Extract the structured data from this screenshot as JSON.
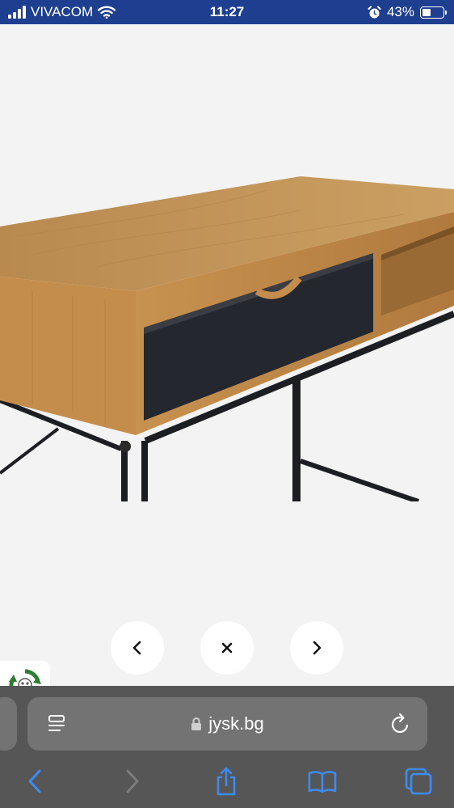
{
  "status_bar": {
    "carrier": "VIVACOM",
    "time": "11:27",
    "battery": "43%",
    "battery_level": 0.43,
    "icons": [
      "signal-icon",
      "wifi-icon",
      "alarm-icon",
      "battery-icon"
    ]
  },
  "viewer": {
    "image": "product-photo-desk-oak-black-drawer",
    "buttons": {
      "prev": "chevron-left-icon",
      "close": "close-icon",
      "next": "chevron-right-icon"
    },
    "badge_icon": "recycle-icon"
  },
  "browser": {
    "domain": "jysk.bg",
    "icons": [
      "reader-icon",
      "lock-icon",
      "reload-icon",
      "back-icon",
      "forward-icon",
      "share-icon",
      "bookmarks-icon",
      "tabs-icon"
    ],
    "colors": {
      "toolbar": "#565656",
      "field": "#737373",
      "accent": "#3d8bf0"
    }
  }
}
